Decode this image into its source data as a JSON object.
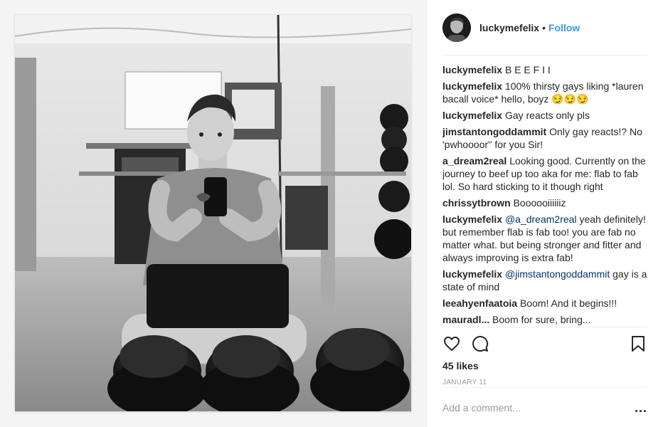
{
  "post": {
    "username": "luckymefelix",
    "separator": "•",
    "follow_label": "Follow"
  },
  "comments": [
    {
      "user": "luckymefelix",
      "mention": "",
      "text": "B E E F I I"
    },
    {
      "user": "luckymefelix",
      "mention": "",
      "text": "100% thirsty gays liking *lauren bacall voice* hello, boyz 😏😏😏"
    },
    {
      "user": "luckymefelix",
      "mention": "",
      "text": "Gay reacts only pls"
    },
    {
      "user": "jimstantongoddammit",
      "mention": "",
      "text": "Only gay reacts!? No 'pwhoooor'' for you Sir!"
    },
    {
      "user": "a_dream2real",
      "mention": "",
      "text": "Looking good. Currently on the journey to beef up too aka for me: flab to fab lol. So hard sticking to it though right"
    },
    {
      "user": "chrissytbrown",
      "mention": "",
      "text": "Boooooiiiiiiz"
    },
    {
      "user": "luckymefelix",
      "mention": "@a_dream2real",
      "text": "yeah definitely! but remember flab is fab too! you are fab no matter what. but being stronger and fitter and always improving is extra fab!"
    },
    {
      "user": "luckymefelix",
      "mention": "@jimstantongoddammit",
      "text": "gay is a state of mind"
    },
    {
      "user": "leeahyenfaatoia",
      "mention": "",
      "text": "Boom! And it begins!!!"
    },
    {
      "user": "mauradl...",
      "mention": "",
      "text": "Boom for sure, bring..."
    }
  ],
  "engagement": {
    "likes": "45 likes",
    "date": "JANUARY 11"
  },
  "composer": {
    "placeholder": "Add a comment...",
    "more_label": "..."
  },
  "icons": [
    "heart-icon",
    "comment-icon",
    "bookmark-icon",
    "more-icon"
  ],
  "colors": {
    "follow_blue": "#3897f0",
    "mention_blue": "#003569",
    "text": "#262626",
    "muted": "#999999"
  }
}
